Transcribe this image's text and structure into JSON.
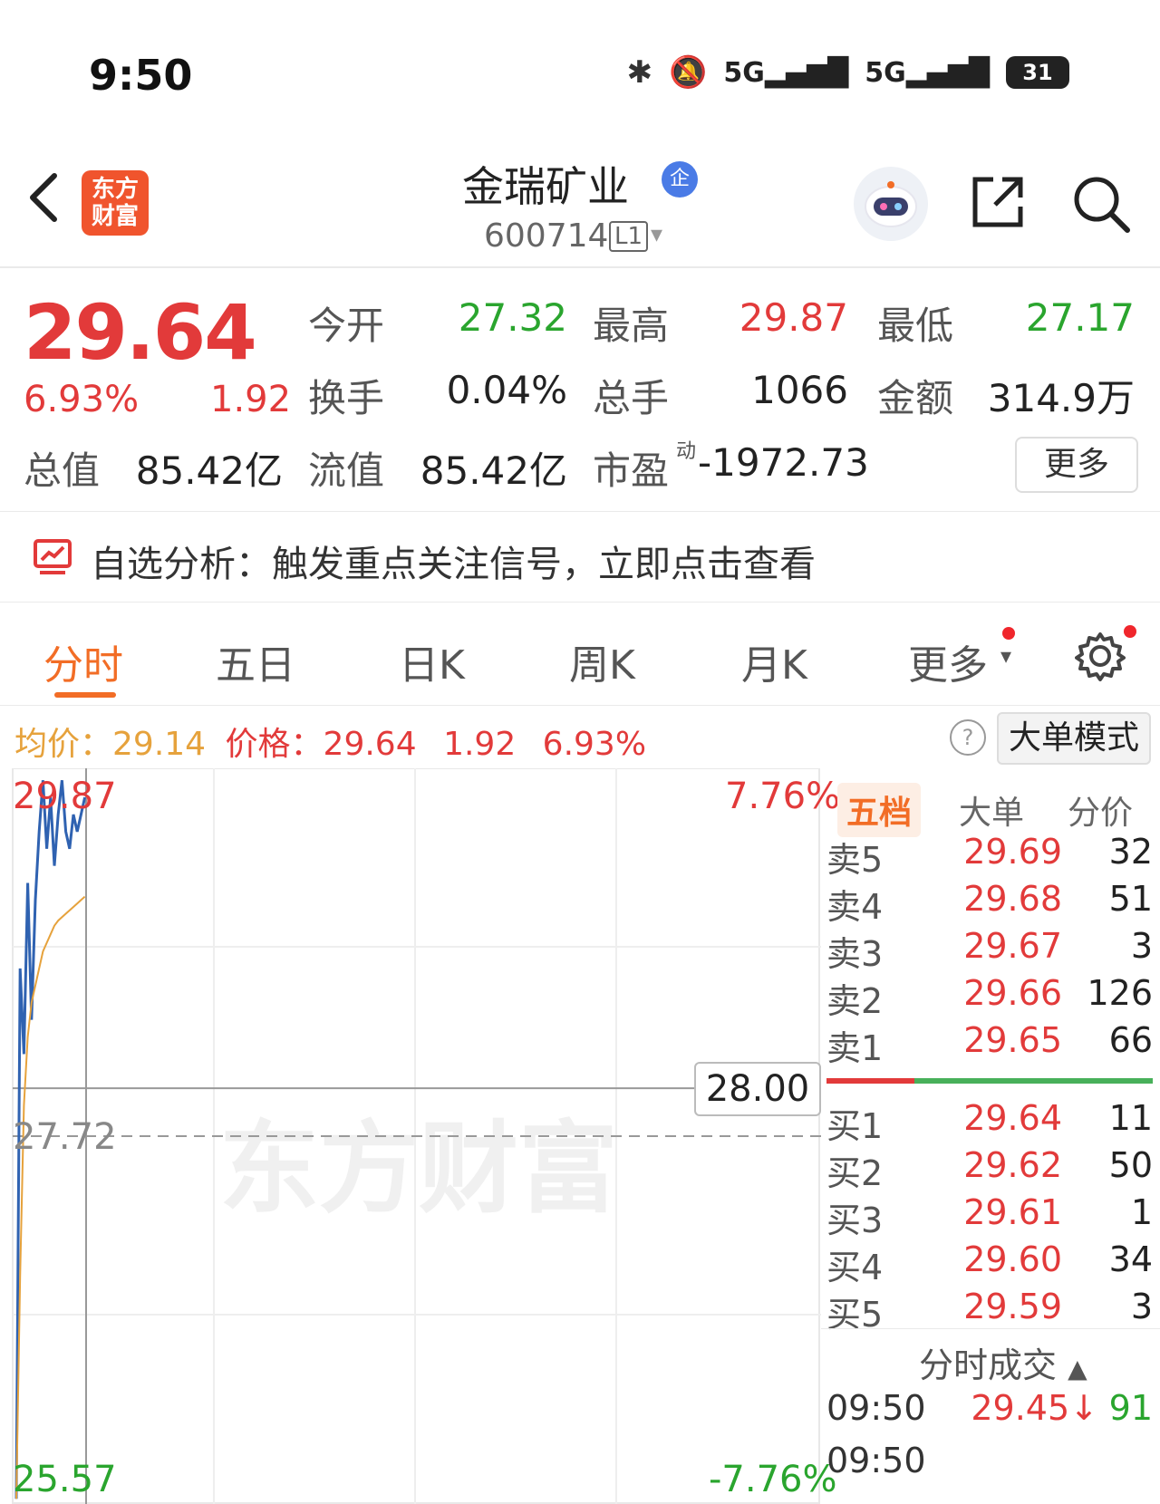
{
  "status_bar": {
    "time": "9:50",
    "network_1": "5G",
    "network_2": "5G",
    "battery": "31"
  },
  "header": {
    "logo_text": "东方财富",
    "title": "金瑞矿业",
    "badge": "企",
    "code": "600714",
    "level": "L1"
  },
  "quote": {
    "price": "29.64",
    "change_pct": "6.93%",
    "change": "1.92",
    "rows": [
      [
        {
          "label": "今开",
          "value": "27.32",
          "color": "green"
        },
        {
          "label": "最高",
          "value": "29.87",
          "color": "red"
        },
        {
          "label": "最低",
          "value": "27.17",
          "color": "green"
        }
      ],
      [
        {
          "label": "换手",
          "value": "0.04%",
          "color": "dark"
        },
        {
          "label": "总手",
          "value": "1066",
          "color": "dark"
        },
        {
          "label": "金额",
          "value": "314.9万",
          "color": "dark"
        }
      ]
    ],
    "market_cap_label": "总值",
    "market_cap": "85.42亿",
    "float_cap_label": "流值",
    "float_cap": "85.42亿",
    "pe_label": "市盈",
    "pe_sup": "动",
    "pe": "-1972.73",
    "more_button": "更多"
  },
  "analysis": {
    "text": "自选分析：触发重点关注信号，立即点击查看"
  },
  "tabs": [
    "分时",
    "五日",
    "日K",
    "周K",
    "月K",
    "更多"
  ],
  "info_line": {
    "avg_label": "均价：",
    "avg": "29.14",
    "price_label": "价格：",
    "price": "29.64",
    "change": "1.92",
    "change_pct": "6.93%"
  },
  "big_mode_button": "大单模式",
  "chart_data": {
    "type": "line",
    "y_max_label": "29.87",
    "y_min_label": "25.57",
    "y_ref_label": "27.72",
    "pct_top": "7.76%",
    "pct_bottom": "-7.76%",
    "crosshair_price": "28.00",
    "ylim": [
      25.57,
      29.87
    ],
    "series": [
      {
        "name": "价格",
        "color": "#2f62b1",
        "x": [
          0,
          1,
          2,
          3,
          4,
          5,
          6,
          7,
          8,
          9,
          10,
          11,
          12,
          13,
          14,
          15,
          16,
          17,
          18
        ],
        "values": [
          25.6,
          28.7,
          28.2,
          29.2,
          28.4,
          29.1,
          29.5,
          29.8,
          29.4,
          29.7,
          29.3,
          29.6,
          29.8,
          29.5,
          29.4,
          29.6,
          29.5,
          29.6,
          29.7
        ]
      },
      {
        "name": "均价",
        "color": "#e6a23c",
        "x": [
          0,
          1,
          2,
          3,
          4,
          5,
          6,
          7,
          8,
          9,
          10,
          11,
          12,
          13,
          14,
          15,
          16,
          17,
          18
        ],
        "values": [
          25.6,
          26.9,
          27.9,
          28.3,
          28.5,
          28.6,
          28.7,
          28.8,
          28.85,
          28.9,
          28.95,
          28.98,
          29.0,
          29.02,
          29.04,
          29.06,
          29.08,
          29.1,
          29.12
        ]
      }
    ]
  },
  "order_book": {
    "tabs": [
      "五档",
      "大单",
      "分价"
    ],
    "asks": [
      {
        "name": "卖5",
        "price": "29.69",
        "vol": "32"
      },
      {
        "name": "卖4",
        "price": "29.68",
        "vol": "51"
      },
      {
        "name": "卖3",
        "price": "29.67",
        "vol": "3"
      },
      {
        "name": "卖2",
        "price": "29.66",
        "vol": "126"
      },
      {
        "name": "卖1",
        "price": "29.65",
        "vol": "66"
      }
    ],
    "bids": [
      {
        "name": "买1",
        "price": "29.64",
        "vol": "11"
      },
      {
        "name": "买2",
        "price": "29.62",
        "vol": "50"
      },
      {
        "name": "买3",
        "price": "29.61",
        "vol": "1"
      },
      {
        "name": "买4",
        "price": "29.60",
        "vol": "34"
      },
      {
        "name": "买5",
        "price": "29.59",
        "vol": "3"
      }
    ],
    "ask_ratio": 0.27
  },
  "trades": {
    "title": "分时成交",
    "rows": [
      {
        "time": "09:50",
        "price": "29.45↓",
        "vol": "91"
      },
      {
        "time": "09:50",
        "price": "",
        "vol": ""
      }
    ]
  },
  "watermark": "东方财富"
}
